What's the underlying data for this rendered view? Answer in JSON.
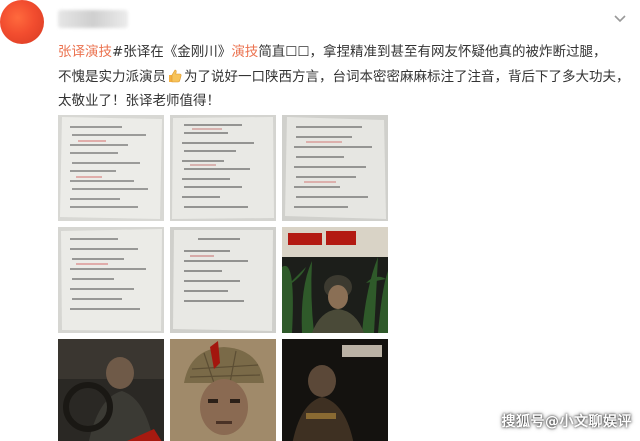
{
  "post": {
    "topic": "张译演技",
    "line1_a": "#张译在",
    "line1_title_a": "《金刚川》",
    "line1_link": "演技",
    "line1_b": "简直☐☐，拿捏精准到甚至有网友怀疑他真的被炸断过腿，",
    "line2_a": "不愧是实力派演员",
    "line2_b": "为了说好一口陕西方言，台词本密密麻麻标注了注音，背后下了多大功夫，",
    "line3": "太敬业了！张译老师值得！"
  },
  "icons": {
    "thumbs_up": "thumbs-up-emoji",
    "menu": "chevron-down-icon"
  },
  "watermark": {
    "text": "搜狐号@小文聊娱评"
  },
  "images": [
    {
      "name": "script-page-1"
    },
    {
      "name": "script-page-2"
    },
    {
      "name": "script-page-3"
    },
    {
      "name": "script-page-4"
    },
    {
      "name": "script-page-5"
    },
    {
      "name": "movie-poster-corn"
    },
    {
      "name": "movie-still-wheel"
    },
    {
      "name": "movie-poster-helmet"
    },
    {
      "name": "movie-poster-dark"
    }
  ],
  "colors": {
    "accent": "#eb7350",
    "text": "#333333",
    "avatar": "#f24d2f"
  }
}
